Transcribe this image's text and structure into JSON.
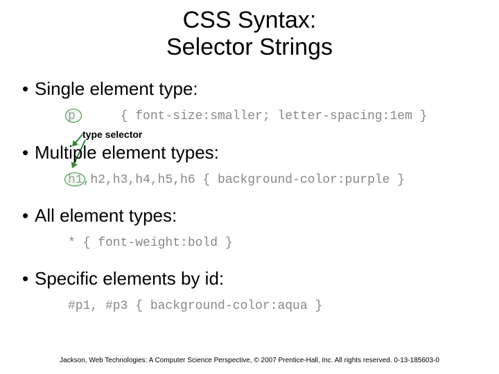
{
  "title_line1": "CSS Syntax:",
  "title_line2": "Selector Strings",
  "bullets": {
    "b1": "Single element type:",
    "b2": "Multiple element types:",
    "b3": "All element types:",
    "b4": "Specific elements by id:"
  },
  "annotation": "type selector",
  "code": {
    "c1": "p      { font-size:smaller; letter-spacing:1em }",
    "c2": "h1,h2,h3,h4,h5,h6 { background-color:purple }",
    "c3": "* { font-weight:bold }",
    "c4": "#p1, #p3 { background-color:aqua }"
  },
  "footer": "Jackson, Web Technologies: A Computer Science Perspective, © 2007 Prentice-Hall, Inc. All rights reserved. 0-13-185603-0"
}
